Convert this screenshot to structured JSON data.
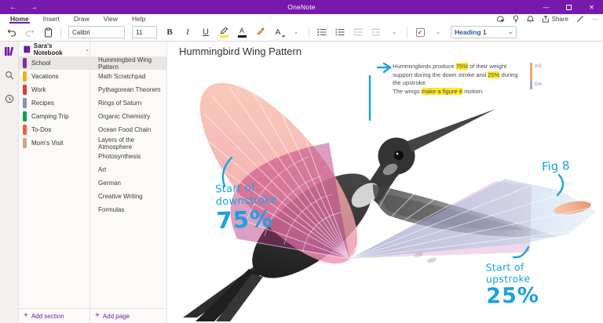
{
  "titlebar": {
    "title": "OneNote",
    "back": "←",
    "forward": "→",
    "minimize": "—",
    "close": "✕"
  },
  "menubar": {
    "tabs": [
      {
        "label": "Home",
        "active": true
      },
      {
        "label": "Insert",
        "active": false
      },
      {
        "label": "Draw",
        "active": false
      },
      {
        "label": "View",
        "active": false
      },
      {
        "label": "Help",
        "active": false
      }
    ],
    "share_label": "Share",
    "ellipsis": "···"
  },
  "toolbar": {
    "font_name": "Calibri",
    "font_size": "11",
    "bold": "B",
    "italic": "I",
    "underline": "U",
    "font_color_letter": "A",
    "clear_format_letter": "A",
    "todo_check": "✓",
    "style_selected": "Heading 1",
    "chevron": "⌄"
  },
  "sidebar": {
    "notebook_name": "Sara's Notebook",
    "sections": [
      {
        "label": "School",
        "color": "#8a2e96"
      },
      {
        "label": "Vacations",
        "color": "#f2b411"
      },
      {
        "label": "Work",
        "color": "#e03e3e"
      },
      {
        "label": "Recipes",
        "color": "#8295a6"
      },
      {
        "label": "Camping Trip",
        "color": "#0fa04c"
      },
      {
        "label": "To-Dos",
        "color": "#f0623a"
      },
      {
        "label": "Mom's Visit",
        "color": "#c9a887"
      }
    ],
    "pages": [
      "Hummingbird Wing Pattern",
      "Math Scratchpad",
      "Pythagorean Theorem",
      "Rings of Saturn",
      "Organic Chemistry",
      "Ocean Food Chain",
      "Layers of the Atmosphere",
      "Photosynthesis",
      "Art",
      "German",
      "Creative Writing",
      "Formulas"
    ],
    "add_section": "Add section",
    "add_page": "Add page",
    "plus": "+"
  },
  "content": {
    "page_title": "Hummingbird Wing Pattern",
    "note": {
      "l1a": "Hummingbirds produce ",
      "l1b": "75%",
      "l1c": " of their weight support during the down stroke and ",
      "l2b": "25%",
      "l2c": " during the upstroke.",
      "l3a": "The wings ",
      "l3b": "make a figure 8",
      "l3c": " motion."
    },
    "authors": [
      {
        "initials": "AS",
        "color": "#efa56f"
      },
      {
        "initials": "DA",
        "color": "#a6a3d8"
      }
    ],
    "ink": {
      "down_l1": "Start of",
      "down_l2": "downstroke",
      "down_pct": "75%",
      "up_l1": "Start of",
      "up_l2": "upstroke",
      "up_pct": "25%",
      "fig": "Fig 8",
      "color": "#1ba1e2"
    }
  },
  "colors": {
    "brand_purple": "#7719aa",
    "highlight_yellow": "#ffe928",
    "ink_cyan": "#1ba1e2",
    "selected_row": "#e8e6e4"
  }
}
